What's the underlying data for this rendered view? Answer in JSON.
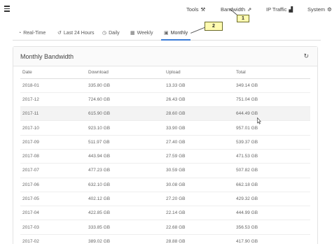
{
  "nav": {
    "menu_icon": "hamburger-icon",
    "items": [
      {
        "label": "Tools",
        "icon": "tools-icon",
        "glyph": "⚒"
      },
      {
        "label": "Bandwidth",
        "icon": "chart-line-icon",
        "glyph": "⇗"
      },
      {
        "label": "IP Traffic",
        "icon": "bar-chart-icon",
        "glyph": "▟"
      },
      {
        "label": "System",
        "icon": "gear-icon",
        "glyph": "⚙"
      }
    ]
  },
  "callouts": [
    "1",
    "2"
  ],
  "tabs": [
    {
      "label": "Real-Time",
      "icon": "dashboard-icon",
      "glyph": "◔"
    },
    {
      "label": "Last 24 Hours",
      "icon": "history-icon",
      "glyph": "↺"
    },
    {
      "label": "Daily",
      "icon": "clock-icon",
      "glyph": "◷"
    },
    {
      "label": "Weekly",
      "icon": "calendar-icon",
      "glyph": "▦"
    },
    {
      "label": "Monthly",
      "icon": "calendar-icon",
      "glyph": "▣"
    }
  ],
  "card": {
    "title": "Monthly Bandwidth",
    "refresh_glyph": "↻"
  },
  "table": {
    "headers": [
      "Date",
      "Download",
      "Upload",
      "Total"
    ],
    "rows": [
      [
        "2018-01",
        "335.80 GB",
        "13.33 GB",
        "349.14 GB"
      ],
      [
        "2017-12",
        "724.60 GB",
        "26.43 GB",
        "751.04 GB"
      ],
      [
        "2017-11",
        "615.90 GB",
        "28.60 GB",
        "644.49 GB"
      ],
      [
        "2017-10",
        "923.10 GB",
        "33.90 GB",
        "957.01 GB"
      ],
      [
        "2017-09",
        "511.97 GB",
        "27.40 GB",
        "539.37 GB"
      ],
      [
        "2017-08",
        "443.94 GB",
        "27.59 GB",
        "471.53 GB"
      ],
      [
        "2017-07",
        "477.23 GB",
        "30.59 GB",
        "507.82 GB"
      ],
      [
        "2017-06",
        "632.10 GB",
        "30.08 GB",
        "662.18 GB"
      ],
      [
        "2017-05",
        "402.12 GB",
        "27.20 GB",
        "429.32 GB"
      ],
      [
        "2017-04",
        "422.85 GB",
        "22.14 GB",
        "444.99 GB"
      ],
      [
        "2017-03",
        "333.85 GB",
        "22.68 GB",
        "356.53 GB"
      ],
      [
        "2017-02",
        "389.02 GB",
        "28.88 GB",
        "417.90 GB"
      ]
    ]
  }
}
